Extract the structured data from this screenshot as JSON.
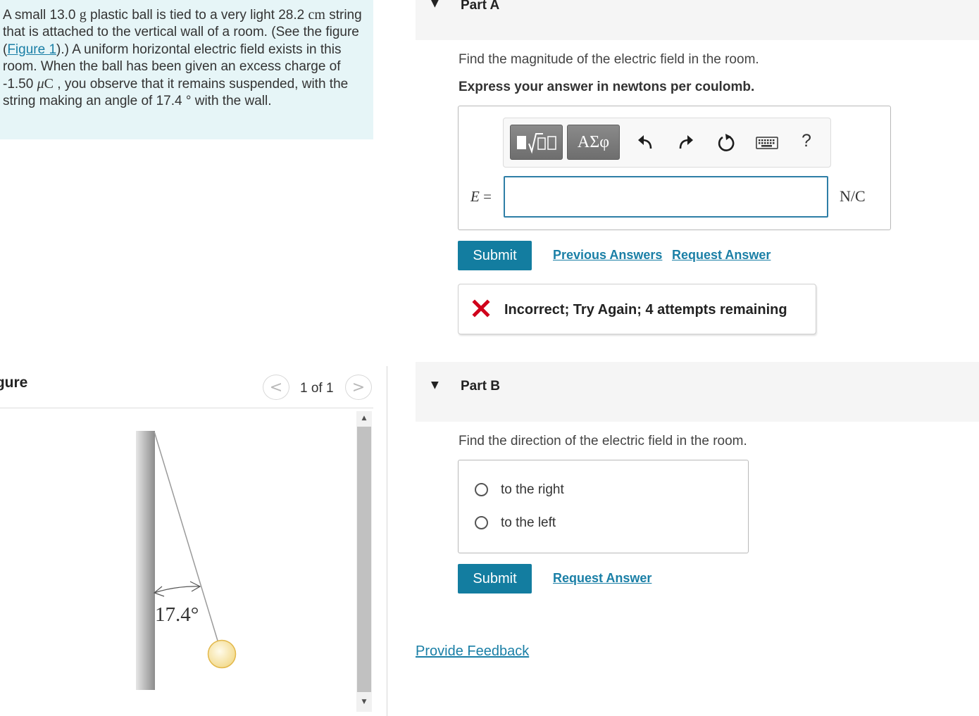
{
  "problem": {
    "s1": "A small 13.0 ",
    "u_g": "g",
    "s2": " plastic ball is tied to a very light 28.2 ",
    "u_cm": "cm",
    "s3": " string that is attached to the vertical wall of a room. (See the figure (",
    "figure_link": "Figure 1",
    "s4": ").) A uniform horizontal electric field exists in this room. When the ball has been given an excess charge of -1.50 ",
    "u_mu": "μ",
    "u_C": "C",
    "s5": " , you observe that it remains suspended, with the string making an angle of 17.4 ",
    "u_deg": "°",
    "s6": " with the wall."
  },
  "figure_panel": {
    "title": "igure",
    "prev_glyph": "<",
    "next_glyph": ">",
    "pager": "1 of 1",
    "angle_label": "17.4°",
    "scroll_up": "▲",
    "scroll_down": "▼"
  },
  "partA": {
    "caret": "▼",
    "title": "Part A",
    "question": "Find the magnitude of the electric field in the room.",
    "instruction": "Express your answer in newtons per coulomb.",
    "toolbar": {
      "templates_icon": "templates-icon",
      "symbols_label": "ΑΣφ",
      "undo_icon": "undo-icon",
      "redo_icon": "redo-icon",
      "reset_icon": "reset-icon",
      "keyboard_icon": "keyboard-icon",
      "help_label": "?"
    },
    "variable": "E",
    "equals": " =",
    "input_value": "",
    "unit": "N/C",
    "submit_label": "Submit",
    "previous_answers_label": "Previous Answers",
    "request_answer_label": "Request Answer",
    "feedback_text": "Incorrect; Try Again; 4 attempts remaining",
    "feedback_color": "#d0021b"
  },
  "partB": {
    "caret": "▼",
    "title": "Part B",
    "question": "Find the direction of the electric field in the room.",
    "options": [
      {
        "label": "to the right",
        "selected": false
      },
      {
        "label": "to the left",
        "selected": false
      }
    ],
    "submit_label": "Submit",
    "request_answer_label": "Request Answer"
  },
  "provide_feedback_label": "Provide Feedback",
  "colors": {
    "accent": "#137da0",
    "link": "#1a7fa6",
    "problem_bg": "#e6f5f7",
    "part_header_bg": "#f5f5f5"
  }
}
